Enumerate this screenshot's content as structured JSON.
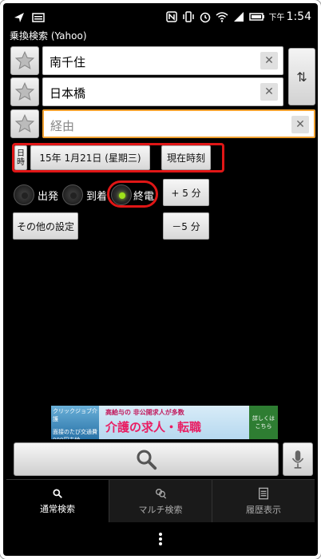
{
  "status_bar": {
    "clock_prefix": "下午",
    "clock_time": "1:54"
  },
  "app": {
    "title": "乗換検索 (Yahoo)"
  },
  "route": {
    "from": "南千住",
    "to": "日本橋",
    "via_placeholder": "経由"
  },
  "datetime": {
    "mode_label": "日時",
    "date_value": "15年 1月21日 (星期三)",
    "now_button": "現在時刻",
    "plus_button": "+ 5 分",
    "minus_button": "－5 分"
  },
  "options": {
    "departure": "出発",
    "arrival": "到着",
    "last_train": "終電",
    "selected": "last_train",
    "other_settings": "その他の設定"
  },
  "ad": {
    "left_text": "クリックジョブ介護",
    "left_sub": "面接のたび交通費 000円支給",
    "top_text": "高給与の 非公開求人が多数",
    "main_text": "介護の求人・転職",
    "right_text": "詳しくは こちら"
  },
  "tabs": [
    {
      "label": "通常検索",
      "icon": "search-icon",
      "active": true
    },
    {
      "label": "マルチ検索",
      "icon": "multi-icon",
      "active": false
    },
    {
      "label": "履歴表示",
      "icon": "history-icon",
      "active": false
    }
  ],
  "colors": {
    "highlight": "#e01616",
    "radio_active": "#9ee21b",
    "via_border": "#f0a030"
  }
}
